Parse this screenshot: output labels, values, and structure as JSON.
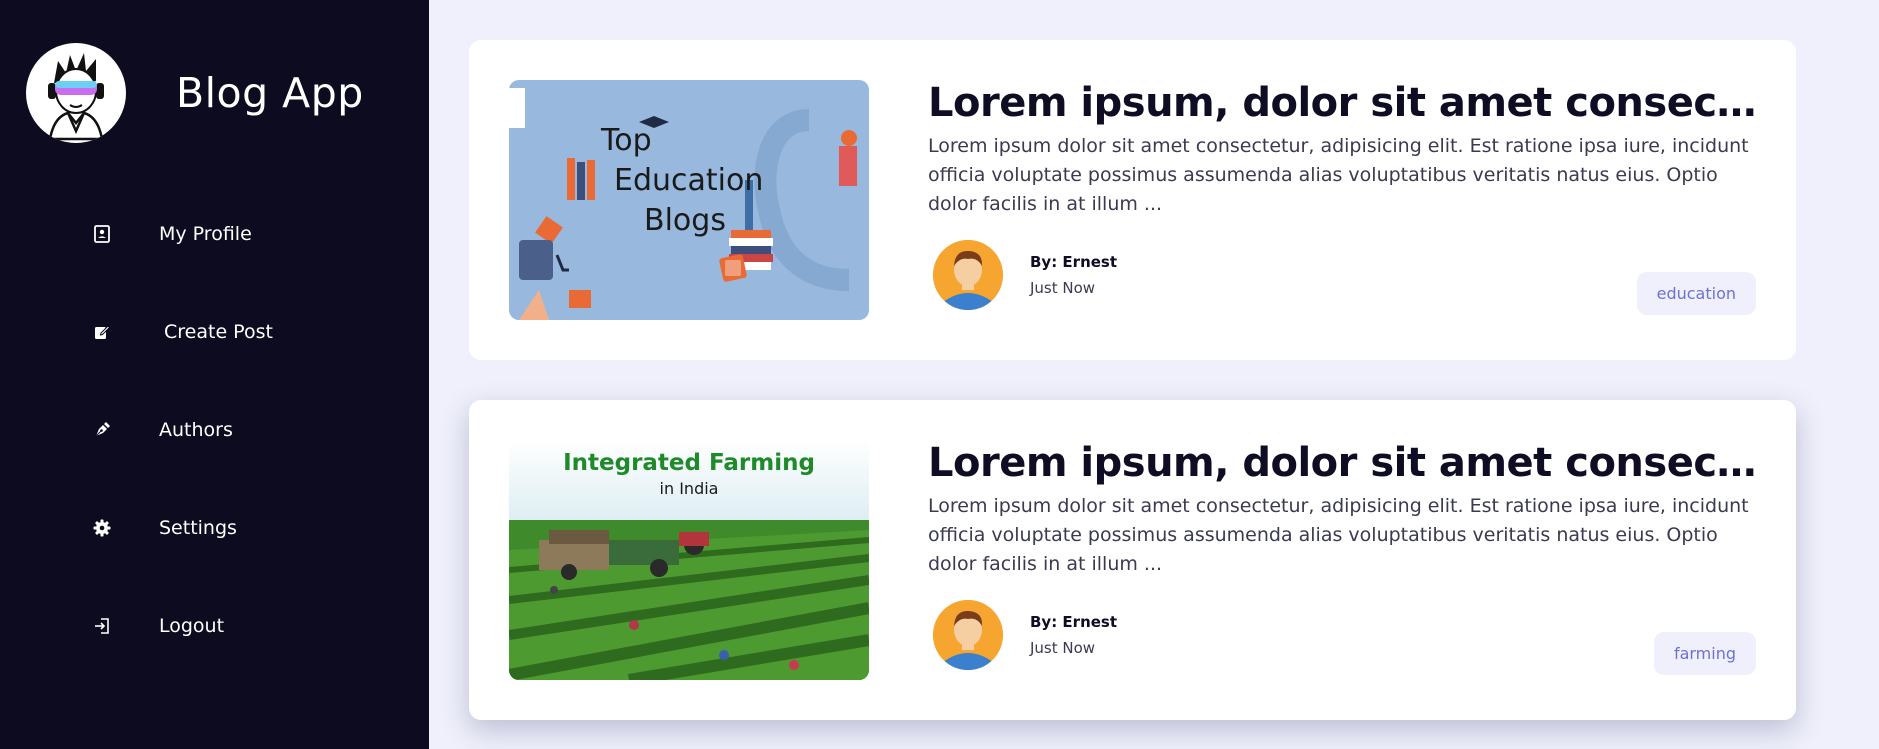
{
  "app": {
    "title": "Blog App",
    "logo_icon": "avatar-vr-headset-icon"
  },
  "sidebar": {
    "items": [
      {
        "label": "My Profile",
        "icon": "profile-icon"
      },
      {
        "label": "Create Post",
        "icon": "edit-icon"
      },
      {
        "label": "Authors",
        "icon": "pen-nib-icon"
      },
      {
        "label": "Settings",
        "icon": "gear-icon"
      },
      {
        "label": "Logout",
        "icon": "logout-icon"
      }
    ]
  },
  "posts": [
    {
      "title": "Lorem ipsum, dolor sit amet consect...",
      "excerpt": "Lorem ipsum dolor sit amet consectetur, adipisicing elit. Est ratione ipsa iure, incidunt officia voluptate possimus assumenda alias voluptatibus veritatis natus eius. Optio dolor facilis in at illum ...",
      "author": "By: Ernest",
      "time": "Just Now",
      "tag": "education",
      "thumb": {
        "line1": "Top",
        "line2": "Education",
        "line3": "Blogs"
      }
    },
    {
      "title": "Lorem ipsum, dolor sit amet consect...",
      "excerpt": "Lorem ipsum dolor sit amet consectetur, adipisicing elit. Est ratione ipsa iure, incidunt officia voluptate possimus assumenda alias voluptatibus veritatis natus eius. Optio dolor facilis in at illum ...",
      "author": "By: Ernest",
      "time": "Just Now",
      "tag": "farming",
      "thumb": {
        "line1": "Integrated Farming",
        "line2": "in India"
      }
    }
  ],
  "colors": {
    "sidebar_bg": "#0c0b20",
    "page_bg": "#eff0fb",
    "tag_text": "#6c72d4",
    "tag_bg": "#eff0fb"
  }
}
